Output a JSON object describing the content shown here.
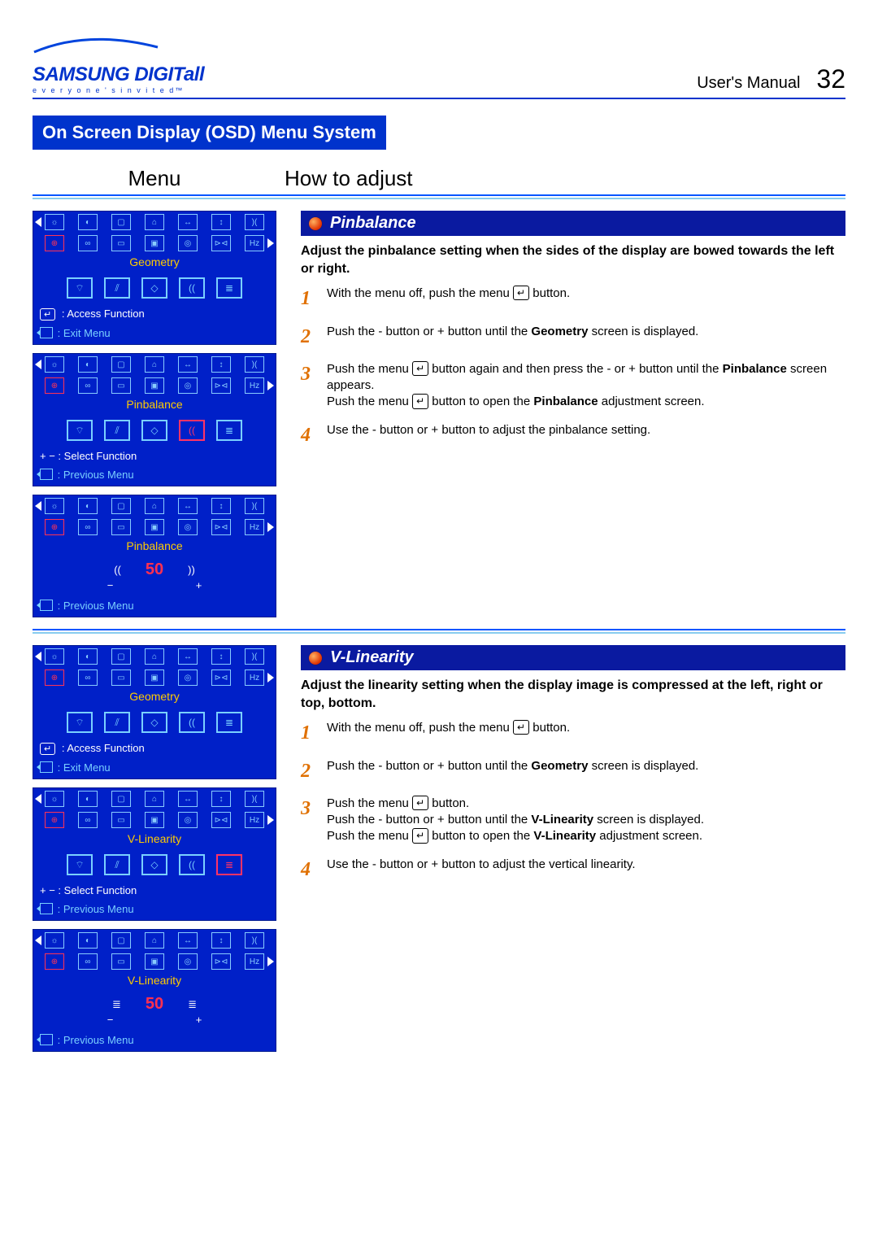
{
  "header": {
    "brand_main": "SAMSUNG DIGIT",
    "brand_suffix": "all",
    "brand_tagline": "e v e r y o n e ' s   i n v i t e d™",
    "doc_label": "User's  Manual",
    "page_number": "32"
  },
  "section_bar": "On Screen Display (OSD) Menu System",
  "col_title_menu": "Menu",
  "col_title_howto": "How to adjust",
  "osd_hints": {
    "access": ": Access Function",
    "exit": ": Exit Menu",
    "select": "Select Function",
    "prev": ": Previous Menu",
    "enter_symbol": "↵",
    "plusminus": "+ − :"
  },
  "osd_labels": {
    "geometry": "Geometry",
    "pinbalance": "Pinbalance",
    "vlinearity": "V-Linearity",
    "value50": "50",
    "minus": "−",
    "plus": "+"
  },
  "topics": [
    {
      "title": "Pinbalance",
      "lead": "Adjust the pinbalance setting when the sides of the display are bowed towards the left or right.",
      "steps": [
        {
          "n": "1",
          "html": "With the menu off, push the menu {ENTER} button."
        },
        {
          "n": "2",
          "html": "Push the  - button or + button until the  {B}Geometry{/B} screen is displayed."
        },
        {
          "n": "3",
          "html": "Push the menu {ENTER} button again and then press the - or + button until the  {B}Pinbalance{/B}  screen appears.\nPush the menu {ENTER} button to open the {B}Pinbalance{/B} adjustment screen."
        },
        {
          "n": "4",
          "html": "Use the  - button or + button to adjust the pinbalance setting."
        }
      ]
    },
    {
      "title": "V-Linearity",
      "lead": "Adjust the linearity setting when the display image is compressed at the left, right or top, bottom.",
      "steps": [
        {
          "n": "1",
          "html": "With the menu off, push the menu {ENTER} button."
        },
        {
          "n": "2",
          "html": "Push the  - button or  + button until the  {B}Geometry{/B} screen is displayed."
        },
        {
          "n": "3",
          "html": "Push the menu {ENTER} button.\nPush the - button or  + button until the  {B}V-Linearity{/B} screen is displayed.\nPush the menu {ENTER} button to open the {B}V-Linearity{/B} adjustment screen."
        },
        {
          "n": "4",
          "html": "Use the   - button or + button to adjust the vertical linearity."
        }
      ]
    }
  ],
  "icon_glyphs_row1": [
    "☼",
    "◐",
    "▢",
    "⌂",
    "↔",
    "↕",
    ")("
  ],
  "icon_glyphs_row2": [
    "⊕",
    "∞",
    "▭",
    "▣",
    "◎",
    "⊳⊲",
    "Hz"
  ],
  "body_icons": [
    "⌔",
    "⫽",
    "◇",
    "((",
    "≣"
  ]
}
